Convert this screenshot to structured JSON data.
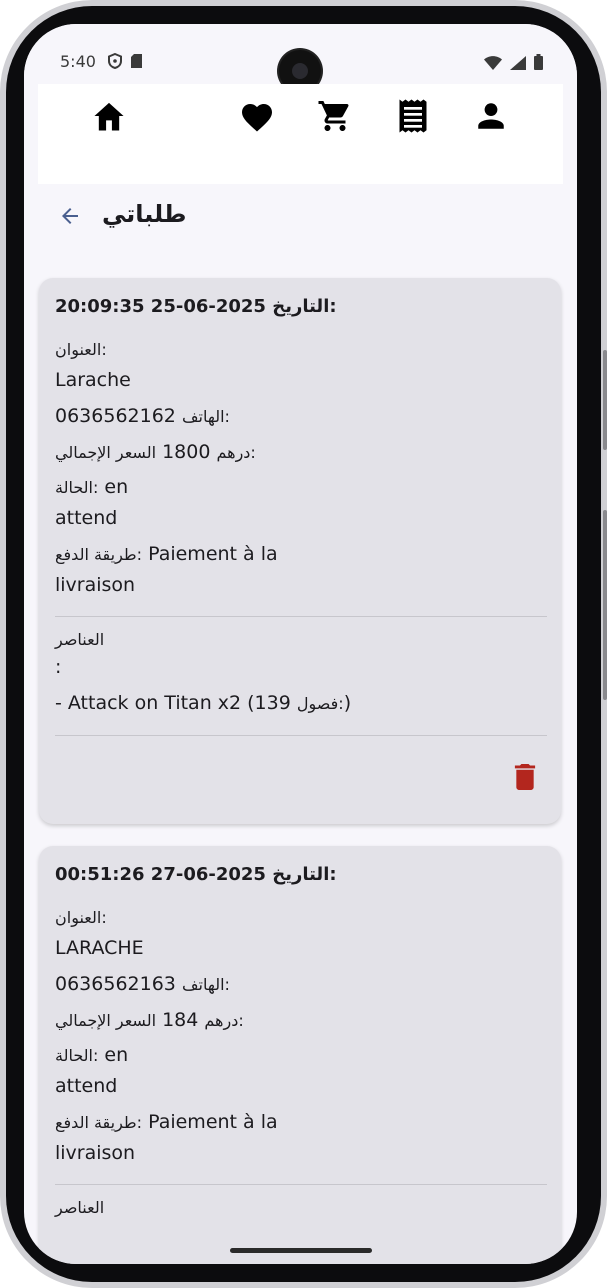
{
  "status_bar": {
    "time": "5:40",
    "left_icons": [
      "shield-icon",
      "sd-card-icon"
    ],
    "right_icons": [
      "wifi-icon",
      "signal-icon",
      "battery-icon"
    ]
  },
  "top_nav": {
    "items": [
      {
        "icon": "home-icon"
      },
      {
        "icon": "heart-icon"
      },
      {
        "icon": "cart-icon"
      },
      {
        "icon": "receipt-icon"
      },
      {
        "icon": "person-icon"
      }
    ]
  },
  "header": {
    "title": "طلباتي",
    "back_icon": "arrow-back-icon"
  },
  "labels": {
    "date": "التاريخ:",
    "address": "العنوان:",
    "phone": "الهاتف:",
    "total": "السعر الإجمالي:",
    "currency": "درهم",
    "status": "الحالة:",
    "payment": "طريقة الدفع:",
    "items": "العناصر",
    "items_colon": ":",
    "chapters": "فصول:"
  },
  "orders": [
    {
      "date": "20:09:35 25-06-2025",
      "address": "Larache",
      "phone": "0636562162",
      "total": "1800",
      "status_line1": "en",
      "status_line2": "attend",
      "payment_line1": "Paiement à la",
      "payment_line2": "livraison",
      "items": [
        {
          "prefix": "- Attack on Titan x2 (139",
          "suffix": ")"
        }
      ]
    },
    {
      "date": "00:51:26 27-06-2025",
      "address": "LARACHE",
      "phone": "0636562163",
      "total": "184",
      "status_line1": "en",
      "status_line2": "attend",
      "payment_line1": "Paiement à la",
      "payment_line2": "livraison",
      "items": []
    }
  ],
  "colors": {
    "card_bg": "#e3e2e8",
    "delete_red": "#b3261e",
    "back_arrow": "#4a5f8f"
  }
}
